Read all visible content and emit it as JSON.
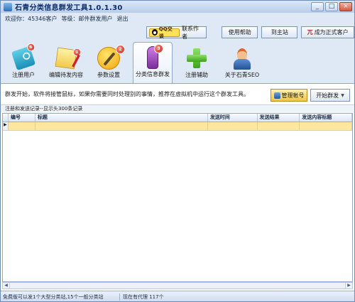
{
  "window": {
    "title": "石青分类信息群发工具1.0.1.30",
    "minimize_glyph": "_",
    "maximize_glyph": "□",
    "close_glyph": "×"
  },
  "user_info": {
    "welcome": "欢迎你：45346客户",
    "level": "等级：邮件群发用户",
    "logout": "退出"
  },
  "top_buttons": {
    "qq_badge": "QQ交谈",
    "contact": "联系作者",
    "help": "使用帮助",
    "home": "到主站",
    "register_icon": "兀",
    "register": "成为正式客户"
  },
  "tools": [
    {
      "label": "注册用户",
      "badge": "6",
      "icon": "card-icon"
    },
    {
      "label": "编辑待发内容",
      "badge": "1",
      "icon": "note-icon"
    },
    {
      "label": "参数设置",
      "badge": "2",
      "icon": "wrench-icon"
    },
    {
      "label": "分类信息群发",
      "badge": "3",
      "icon": "mic-icon"
    },
    {
      "label": "注册辅助",
      "icon": "plus-icon"
    },
    {
      "label": "关于石青SEO",
      "icon": "person-icon"
    }
  ],
  "panel": {
    "description": "群发开始，软件将接管鼠标，如果你需要同时处理别的事情，推荐在虚拟机中运行这个群发工具。",
    "manage_button": "管理帐号",
    "start_button": "开始群发",
    "records_label": "注册和发送记录--显示头300条记录"
  },
  "grid": {
    "columns": [
      "编号",
      "标题",
      "发送时间",
      "发送结果",
      "发送内容标题"
    ],
    "row_indicator": "▶"
  },
  "status": {
    "left": "免费版可以发1个大型分类站,15个一般分类站",
    "right": "现在有代理 117个"
  },
  "colors": {
    "accent": "#1b2c48",
    "selected_row": "#fde7a0",
    "badge_red": "#c81e13"
  }
}
